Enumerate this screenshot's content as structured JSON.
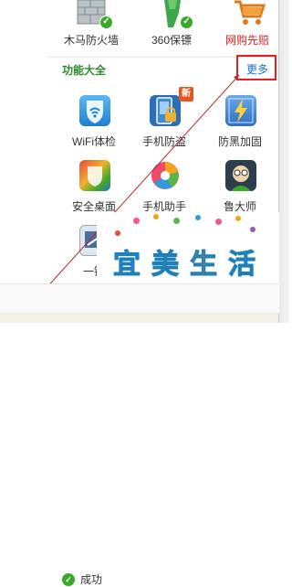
{
  "top_tools": [
    {
      "label": "木马防火墙",
      "icon": "firewall-wall-icon",
      "checked": true
    },
    {
      "label": "360保镖",
      "icon": "bodyguard-figure-icon",
      "checked": true
    },
    {
      "label": "网购先赔",
      "icon": "shopping-cart-icon",
      "checked": false,
      "color": "#e02020"
    }
  ],
  "features": {
    "title": "功能大全",
    "more_label": "更多",
    "items": [
      {
        "label": "WiFi体检",
        "icon": "wifi-shield-icon"
      },
      {
        "label": "手机防盗",
        "icon": "phone-lock-icon",
        "badge": "新"
      },
      {
        "label": "防黑加固",
        "icon": "lightning-shield-icon"
      },
      {
        "label": "安全桌面",
        "icon": "desktop-shield-icon"
      },
      {
        "label": "手机助手",
        "icon": "phone-assistant-icon"
      },
      {
        "label": "鲁大师",
        "icon": "master-lu-icon"
      },
      {
        "label": "一键",
        "icon": "one-click-icon"
      }
    ]
  },
  "status": {
    "text": "成功"
  },
  "watermark": {
    "text": "宜美生活"
  },
  "colors": {
    "accent_green": "#2d8a2d",
    "link_blue": "#1a6fd0",
    "highlight_red": "#e32020"
  }
}
